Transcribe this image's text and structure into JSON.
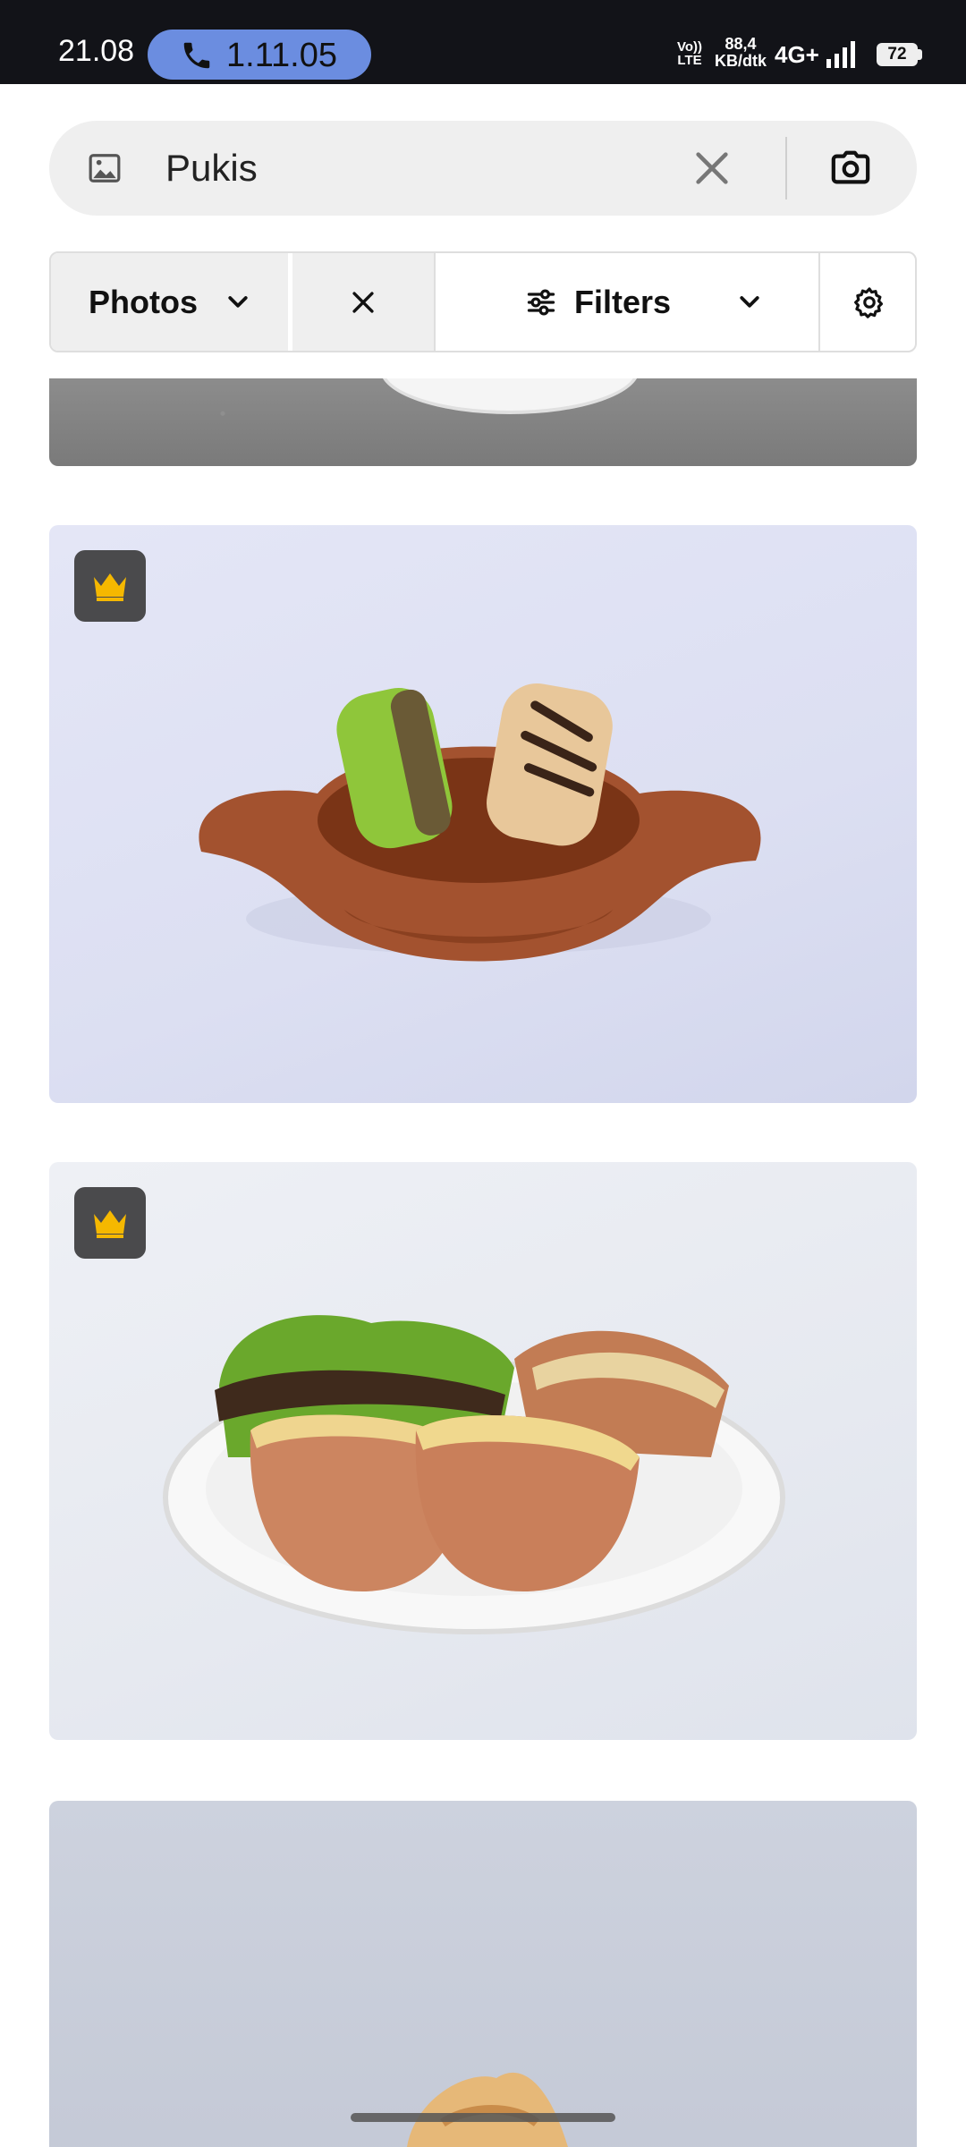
{
  "status_bar": {
    "time": "21.08",
    "call_timer": "1.11.05",
    "volte_top": "Vo))",
    "volte_bottom": "LTE",
    "speed_value": "88,4",
    "speed_unit": "KB/dtk",
    "network": "4G+",
    "battery": "72",
    "call_pill_color": "#6b8de0"
  },
  "search": {
    "query": "Pukis",
    "image_icon": "image-icon",
    "clear_icon": "close-icon",
    "camera_icon": "camera-icon"
  },
  "filter_bar": {
    "media_type_label": "Photos",
    "filters_label": "Filters",
    "settings_icon": "gear-icon"
  },
  "results": {
    "items": [
      {
        "premium": false,
        "partial": true
      },
      {
        "premium": true,
        "badge_icon": "crown-icon"
      },
      {
        "premium": true,
        "badge_icon": "crown-icon"
      },
      {
        "premium": false,
        "partial": true
      }
    ],
    "premium_badge_color": "#f5b800"
  }
}
